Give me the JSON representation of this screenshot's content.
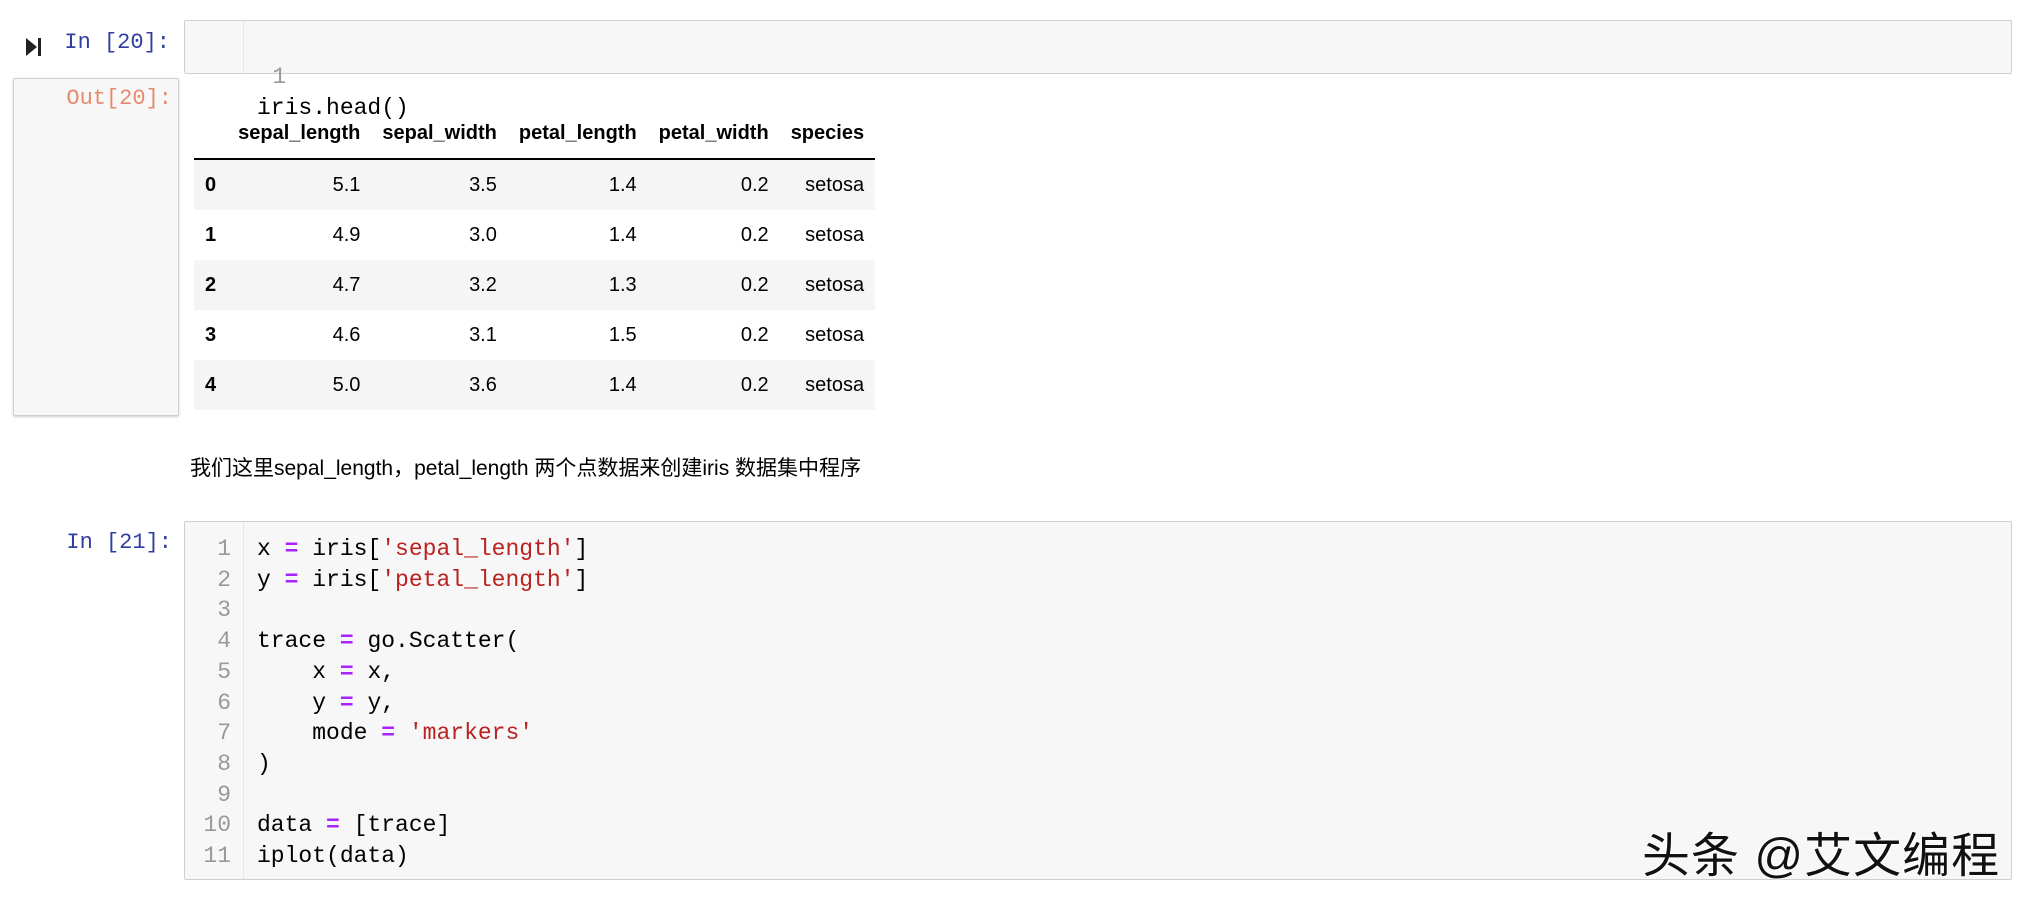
{
  "cells": {
    "cell20": {
      "in_prompt": "In [20]:",
      "out_prompt": "Out[20]:",
      "lines": [
        {
          "n": "1",
          "code": "iris.head()"
        }
      ],
      "table": {
        "columns": [
          "",
          "sepal_length",
          "sepal_width",
          "petal_length",
          "petal_width",
          "species"
        ],
        "rows": [
          [
            "0",
            "5.1",
            "3.5",
            "1.4",
            "0.2",
            "setosa"
          ],
          [
            "1",
            "4.9",
            "3.0",
            "1.4",
            "0.2",
            "setosa"
          ],
          [
            "2",
            "4.7",
            "3.2",
            "1.3",
            "0.2",
            "setosa"
          ],
          [
            "3",
            "4.6",
            "3.1",
            "1.5",
            "0.2",
            "setosa"
          ],
          [
            "4",
            "5.0",
            "3.6",
            "1.4",
            "0.2",
            "setosa"
          ]
        ]
      }
    },
    "markdown": "我们这里sepal_length，petal_length 两个点数据来创建iris 数据集中程序",
    "cell21": {
      "in_prompt": "In [21]:",
      "lines": [
        {
          "n": "1",
          "a": "x ",
          "op": "=",
          "b": " iris[",
          "s": "'sepal_length'",
          "c": "]"
        },
        {
          "n": "2",
          "a": "y ",
          "op": "=",
          "b": " iris[",
          "s": "'petal_length'",
          "c": "]"
        },
        {
          "n": "3",
          "a": "",
          "op": "",
          "b": "",
          "s": "",
          "c": ""
        },
        {
          "n": "4",
          "a": "trace ",
          "op": "=",
          "b": " go.Scatter(",
          "s": "",
          "c": ""
        },
        {
          "n": "5",
          "a": "    x ",
          "op": "=",
          "b": " x,",
          "s": "",
          "c": ""
        },
        {
          "n": "6",
          "a": "    y ",
          "op": "=",
          "b": " y,",
          "s": "",
          "c": ""
        },
        {
          "n": "7",
          "a": "    mode ",
          "op": "=",
          "b": " ",
          "s": "'markers'",
          "c": ""
        },
        {
          "n": "8",
          "a": ")",
          "op": "",
          "b": "",
          "s": "",
          "c": ""
        },
        {
          "n": "9",
          "a": "",
          "op": "",
          "b": "",
          "s": "",
          "c": ""
        },
        {
          "n": "10",
          "a": "data ",
          "op": "=",
          "b": " [trace]",
          "s": "",
          "c": ""
        },
        {
          "n": "11",
          "a": "iplot(data)",
          "op": "",
          "b": "",
          "s": "",
          "c": ""
        }
      ]
    }
  },
  "watermark": "头条 @艾文编程",
  "colors": {
    "prompt_in": "#303f9f",
    "prompt_out": "#d84315",
    "string": "#ba2121",
    "operator": "#aa22ff"
  }
}
